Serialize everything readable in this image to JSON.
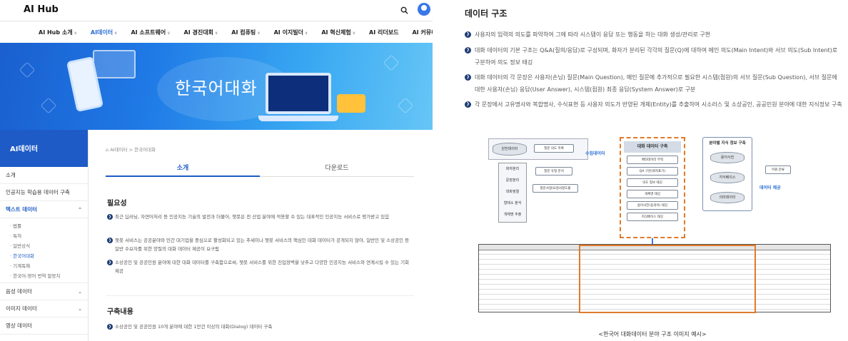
{
  "header": {
    "logo_text": "AI Hub"
  },
  "nav": {
    "items": [
      "AI Hub 소개",
      "AI데이터",
      "AI 소프트웨어",
      "AI 경진대회",
      "AI 컴퓨팅",
      "AI 이지빌더",
      "AI 혁신체험",
      "AI 리더보드",
      "AI 커뮤니티"
    ]
  },
  "hero": {
    "title": "한국어대화"
  },
  "sidebar": {
    "header": "AI데이터",
    "items": [
      "소개",
      "인공지능 학습용 데이터 구축",
      "텍스트 데이터"
    ],
    "sub_items": [
      "법률",
      "특허",
      "일반상식",
      "한국어대화",
      "기계독해",
      "한국어-영어 번역 말뭉치"
    ],
    "after_items": [
      "음성 데이터",
      "이미지 데이터",
      "영상 데이터"
    ]
  },
  "content": {
    "breadcrumb": "AI데이터 > 한국어대화",
    "tabs": [
      "소개",
      "다운로드"
    ],
    "section1_title": "필요성",
    "section1_bullets": [
      "최근 딥러닝, 자연어처리 등 인공지능 기술의 발전과 더불어, 챗봇은 전 산업 분야에 적용할 수 있는 대표적인 인공지능 서비스로 평가받고 있음",
      "챗봇 서비스는 공공분야와 민간 대기업을 중심으로 활성화되고 있는 추세이나 챗봇 서비스의 핵심인 대화 데이터가 공개되지 않아, 일반인 및 소상공인 등 일반 수요자를 위한 양질의 대화 데이터 제공이 요구됨",
      "소상공인 및 공공민원 분야에 대한 대화 데이터를 구축함으로써, 챗봇 서비스를 위한 진입장벽을 낮추고 다양한 인공지능 서비스와 연계시킬 수 있는 기회 제공"
    ],
    "section2_title": "구축내용",
    "section2_bullets": [
      "소상공인 및 공공민원 10개 분야에 대한 1만건 이상의 대화(Dialog) 데이터 구축"
    ]
  },
  "right": {
    "title": "데이터 구조",
    "bullets": [
      "사용자의 입력의 의도를 파악하여 그에 따라 시스템이 응답 또는 행동을 하는 대화 생성/관리로 구현",
      "대화 데이터의 기본 구조는 Q&A(질의/응답)로 구성되며, 화자가 분리된 각각의 질문(Q)에 대하여 메인 의도(Main Intent)와 서브 의도(Sub Intent)로 구분하여 의도 정보 태깅",
      "대화 데이터의 각 문장은 사용자(손님) 질문(Main Question), 메인 질문에 추가적으로 필요한 시스템(점원)의 서브 질문(Sub Question), 서브 질문에 대한 사용자(손님) 응답(User Answer), 시스템(점원) 최종 응답(System Answer)로 구분",
      "각 문장에서 고유명사와 복합명사, 수식표현 등 사용자 의도가 반영된 개체(Entity)를 추출하여 시소러스 및 소상공인, 공공민원 분야에 대한 지식정보 구축"
    ],
    "caption": "<한국어 대화데이터 분야 구조 이미지 예시>",
    "diagram": {
      "center_title": "대화 데이터 구축",
      "center_steps": [
        "메타데이터 부착",
        "QA 구분(화자표기)",
        "의도 정보 태깅",
        "개체명 태깅",
        "용어사전(동의어) 태깅",
        "지식베이스 태깅"
      ],
      "left_top": "원천데이터",
      "left_items": [
        "화자분리",
        "문장분리",
        "대화정렬",
        "형태소 분석",
        "개체명 추출"
      ],
      "intent_items": [
        "질문 의도 목록",
        "질문 유형 분석",
        "질문사항/요청사항도출"
      ],
      "collect_label": "수집데이터",
      "kb_title": "분야별 지식 정보 구축",
      "kb_items": [
        "용어사전",
        "지식베이스",
        "의미데이터"
      ],
      "kb_side": "어휘 분류",
      "provide_label": "데이터 제공"
    }
  }
}
